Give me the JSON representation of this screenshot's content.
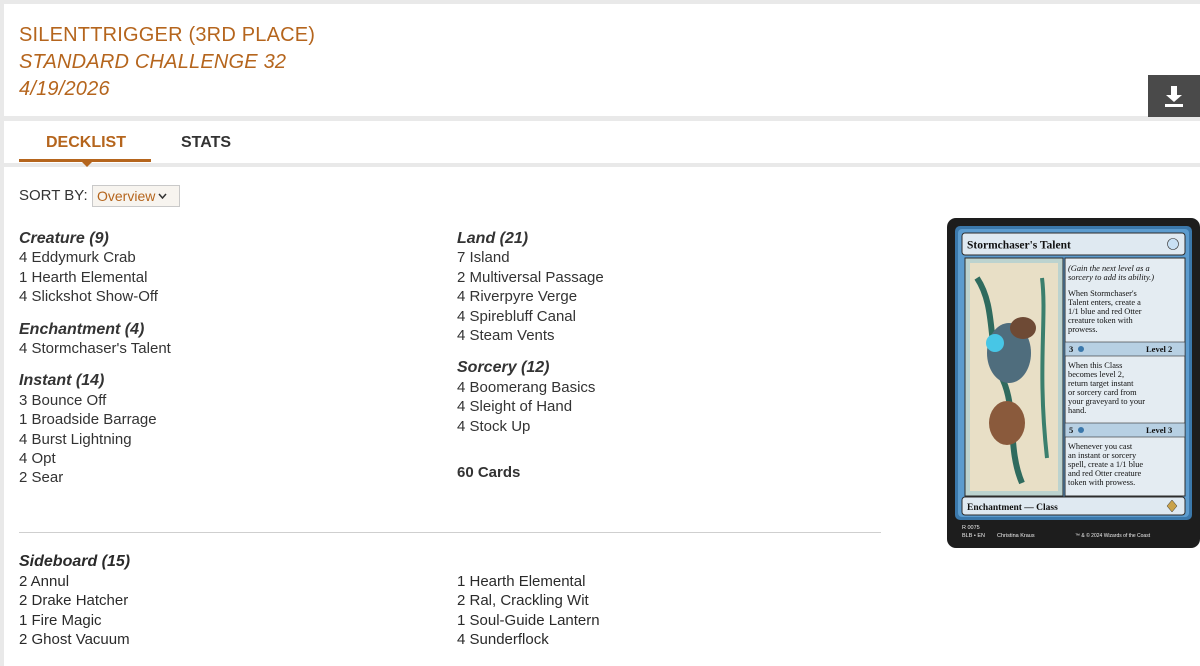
{
  "header": {
    "player": "SILENTTRIGGER (3RD PLACE)",
    "event": "STANDARD CHALLENGE 32",
    "date": "4/19/2026"
  },
  "icons": {
    "download": "download-icon",
    "chevron": "chevron-down-icon"
  },
  "tabs": [
    {
      "label": "DECKLIST",
      "active": true
    },
    {
      "label": "STATS",
      "active": false
    }
  ],
  "sort": {
    "label": "SORT BY:",
    "selected": "Overview"
  },
  "deck": {
    "left_groups": [
      {
        "title": "Creature (9)",
        "cards": [
          "4 Eddymurk Crab",
          "1 Hearth Elemental",
          "4 Slickshot Show-Off"
        ]
      },
      {
        "title": "Enchantment (4)",
        "cards": [
          "4 Stormchaser's Talent"
        ]
      },
      {
        "title": "Instant (14)",
        "cards": [
          "3 Bounce Off",
          "1 Broadside Barrage",
          "4 Burst Lightning",
          "4 Opt",
          "2 Sear"
        ]
      }
    ],
    "right_groups": [
      {
        "title": "Land (21)",
        "cards": [
          "7 Island",
          "2 Multiversal Passage",
          "4 Riverpyre Verge",
          "4 Spirebluff Canal",
          "4 Steam Vents"
        ]
      },
      {
        "title": "Sorcery (12)",
        "cards": [
          "4 Boomerang Basics",
          "4 Sleight of Hand",
          "4 Stock Up"
        ]
      }
    ],
    "total": "60 Cards"
  },
  "sideboard": {
    "title": "Sideboard (15)",
    "left": [
      "2 Annul",
      "2 Drake Hatcher",
      "1 Fire Magic",
      "2 Ghost Vacuum"
    ],
    "right": [
      "1 Hearth Elemental",
      "2 Ral, Crackling Wit",
      "1 Soul-Guide Lantern",
      "4 Sunderflock"
    ]
  },
  "card_preview": {
    "name": "Stormchaser's Talent",
    "type_line": "Enchantment — Class",
    "level1_text": [
      "(Gain the next level as a",
      "sorcery to add its ability.)",
      "When Stormchaser's",
      "Talent enters, create a",
      "1/1 blue and red Otter",
      "creature token with",
      "prowess."
    ],
    "level2_cost": "3",
    "level2_label": "Level 2",
    "level2_text": [
      "When this Class",
      "becomes level 2,",
      "return target instant",
      "or sorcery card from",
      "your graveyard to your",
      "hand."
    ],
    "level3_cost": "5",
    "level3_label": "Level 3",
    "level3_text": [
      "Whenever you cast",
      "an instant or sorcery",
      "spell, create a 1/1 blue",
      "and red Otter creature",
      "token with prowess."
    ],
    "footer_left": [
      "R 0075",
      "BLB • EN",
      "Christina Kraus"
    ],
    "footer_right": "™ & © 2024 Wizards of the Coast",
    "colors": {
      "frame": "#1d1d1d",
      "blue": "#4a93c9",
      "text_box": "#e4ecf2",
      "accent": "#b5651d"
    }
  }
}
